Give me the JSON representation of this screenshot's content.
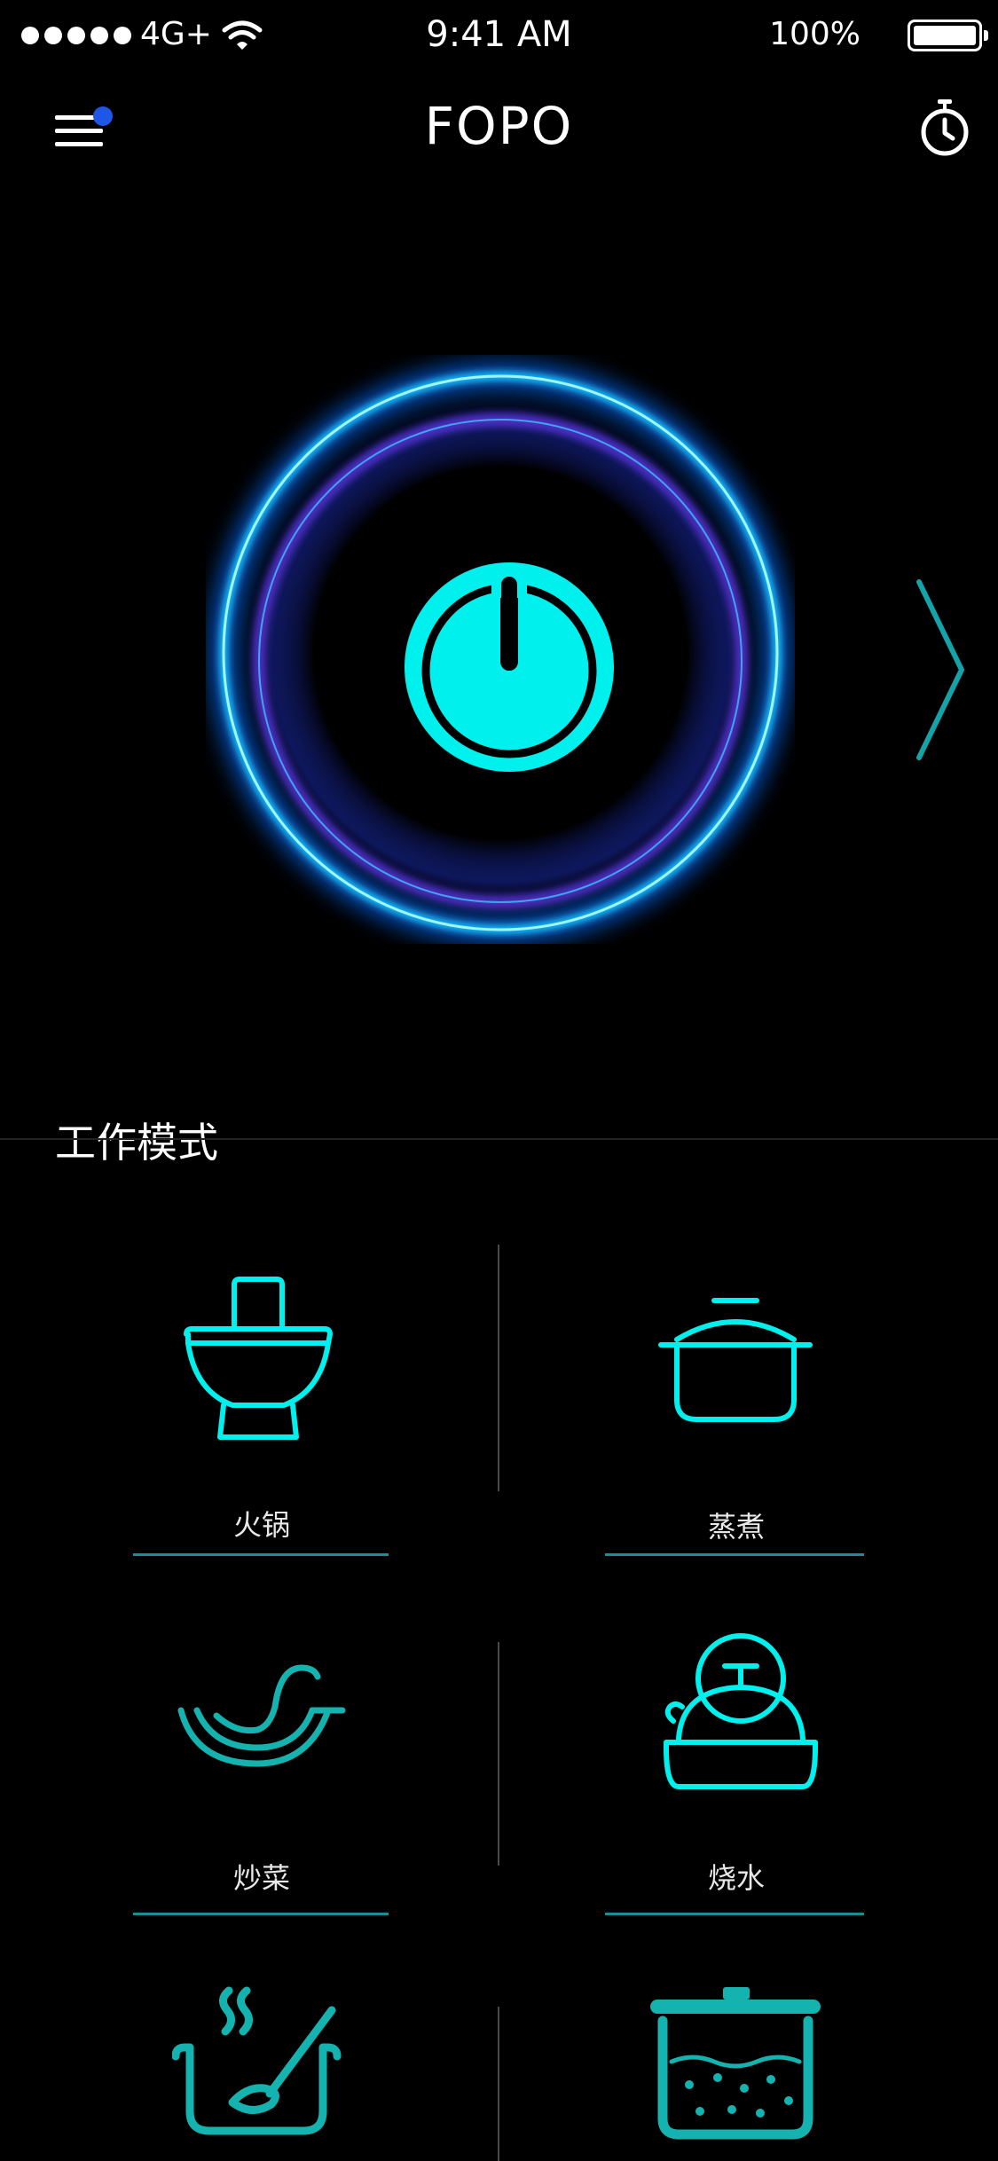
{
  "status_bar": {
    "network": "4G+",
    "time": "9:41 AM",
    "battery": "100%"
  },
  "header": {
    "title": "FOPO",
    "menu_icon": "hamburger-menu-icon",
    "timer_icon": "stopwatch-icon"
  },
  "power": {
    "icon": "power-icon"
  },
  "section": {
    "title": "工作模式"
  },
  "modes": [
    {
      "label": "火锅",
      "icon": "hotpot-icon"
    },
    {
      "label": "蒸煮",
      "icon": "steam-pot-icon"
    },
    {
      "label": "炒菜",
      "icon": "wok-icon"
    },
    {
      "label": "烧水",
      "icon": "kettle-icon"
    },
    {
      "label": "",
      "icon": "soup-ladle-icon"
    },
    {
      "label": "",
      "icon": "stockpot-icon"
    }
  ],
  "colors": {
    "accent": "#00f0ee",
    "accent_dark": "#14b3b0",
    "notification": "#1e57e6",
    "line": "#1b8e95"
  }
}
